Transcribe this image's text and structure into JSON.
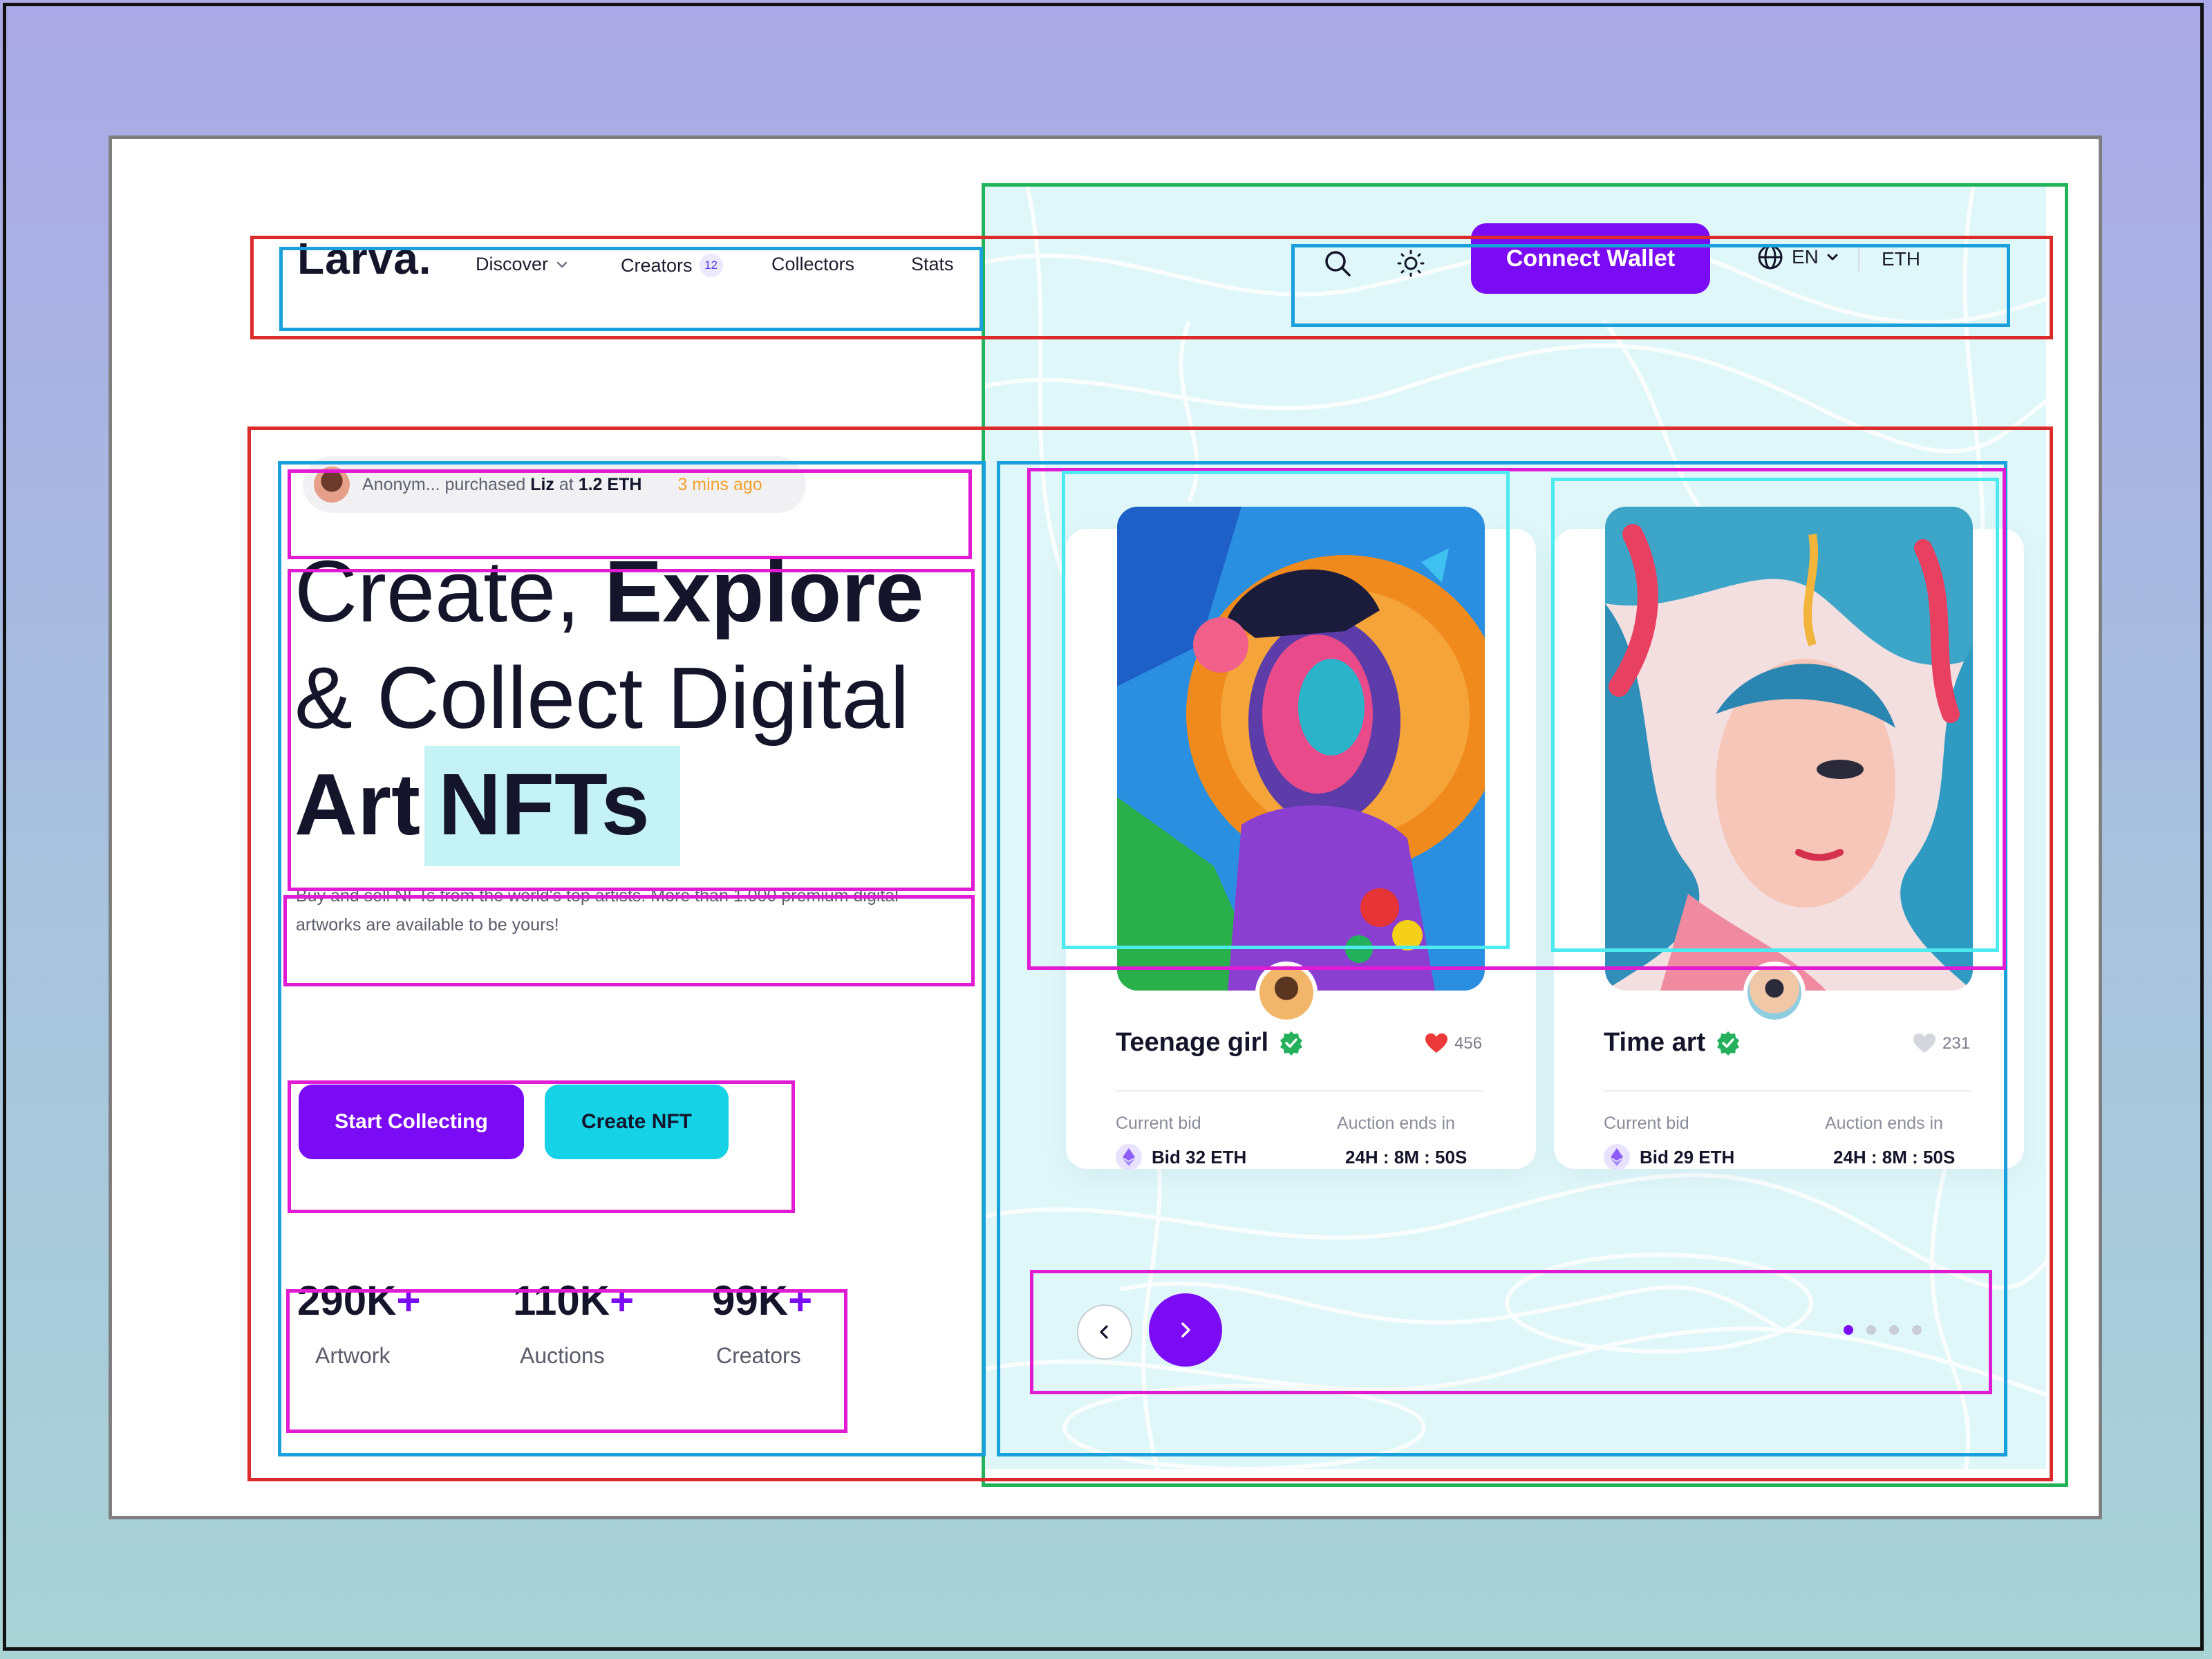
{
  "brand": {
    "logo": "Larva."
  },
  "nav": {
    "items": [
      {
        "label": "Discover",
        "has_dropdown": true
      },
      {
        "label": "Creators",
        "badge": "12"
      },
      {
        "label": "Collectors"
      },
      {
        "label": "Stats"
      }
    ],
    "search_icon": "search-icon",
    "theme_icon": "sun-icon",
    "connect_label": "Connect Wallet",
    "language": "EN",
    "currency": "ETH"
  },
  "activity": {
    "user": "Anonym...",
    "action": "purchased",
    "item": "Liz",
    "at": "at",
    "price": "1.2 ETH",
    "time": "3 mins ago"
  },
  "hero": {
    "line1_regular": "Create, ",
    "line1_bold": "Explore",
    "line2": "& Collect Digital",
    "line3_bold": "Art",
    "line3_highlight": "NFTs",
    "description": "Buy and sell NFTs from the world's top artists. More than 1.000 premium digital artworks are available to be yours!",
    "primary_cta": "Start Collecting",
    "secondary_cta": "Create NFT"
  },
  "stats": [
    {
      "value": "290K",
      "suffix": "+",
      "label": "Artwork"
    },
    {
      "value": "110K",
      "suffix": "+",
      "label": "Auctions"
    },
    {
      "value": "99K",
      "suffix": "+",
      "label": "Creators"
    }
  ],
  "cards": [
    {
      "title": "Teenage girl",
      "verified": true,
      "likes": "456",
      "liked": true,
      "bid_label": "Current bid",
      "bid_value": "Bid 32 ETH",
      "ends_label": "Auction ends in",
      "ends_value": "24H : 8M : 50S"
    },
    {
      "title": "Time art",
      "verified": true,
      "likes": "231",
      "liked": false,
      "bid_label": "Current bid",
      "bid_value": "Bid 29 ETH",
      "ends_label": "Auction ends in",
      "ends_value": "24H : 8M : 50S"
    }
  ],
  "carousel": {
    "total_dots": 4,
    "active_index": 0
  },
  "colors": {
    "primary": "#7b0bf5",
    "accent": "#16d2e6",
    "text": "#14142b",
    "highlight": "#c4f2f5"
  }
}
